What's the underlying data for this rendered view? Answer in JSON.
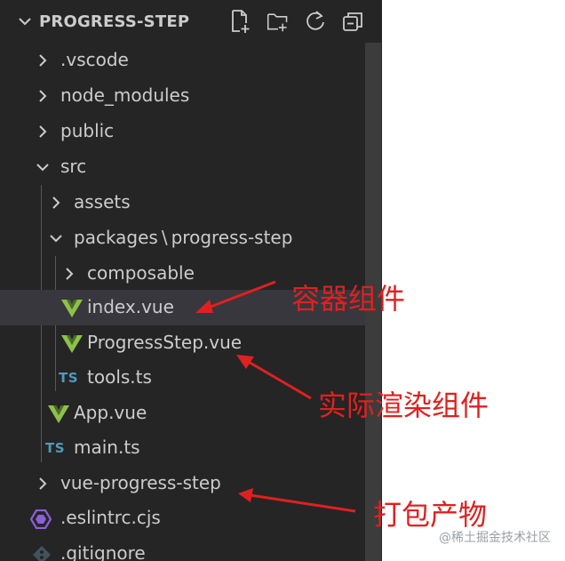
{
  "explorer": {
    "root_title": "PROGRESS-STEP",
    "actions": [
      {
        "name": "new-file-icon"
      },
      {
        "name": "new-folder-icon"
      },
      {
        "name": "refresh-icon"
      },
      {
        "name": "collapse-all-icon"
      }
    ],
    "tree": {
      "vscode": ".vscode",
      "node_modules": "node_modules",
      "public": "public",
      "src": "src",
      "assets": "assets",
      "packages": "packages",
      "path_separator": "\\",
      "progress_step": "progress-step",
      "composable": "composable",
      "index_vue": "index.vue",
      "progress_step_vue": "ProgressStep.vue",
      "tools_ts": "tools.ts",
      "app_vue": "App.vue",
      "main_ts": "main.ts",
      "vue_progress_step": "vue-progress-step",
      "eslintrc": ".eslintrc.cjs",
      "gitignore": ".gitignore",
      "ts_badge": "TS"
    },
    "colors": {
      "vue_green": "#41b883",
      "vue_dark": "#a8d56a",
      "ts_blue": "#519aba",
      "eslint_purple": "#8e5fd6"
    }
  },
  "annotations": {
    "container": "容器组件",
    "renderer": "实际渲染组件",
    "build_output": "打包产物",
    "color": "#e02020"
  },
  "watermark": "@稀土掘金技术社区"
}
